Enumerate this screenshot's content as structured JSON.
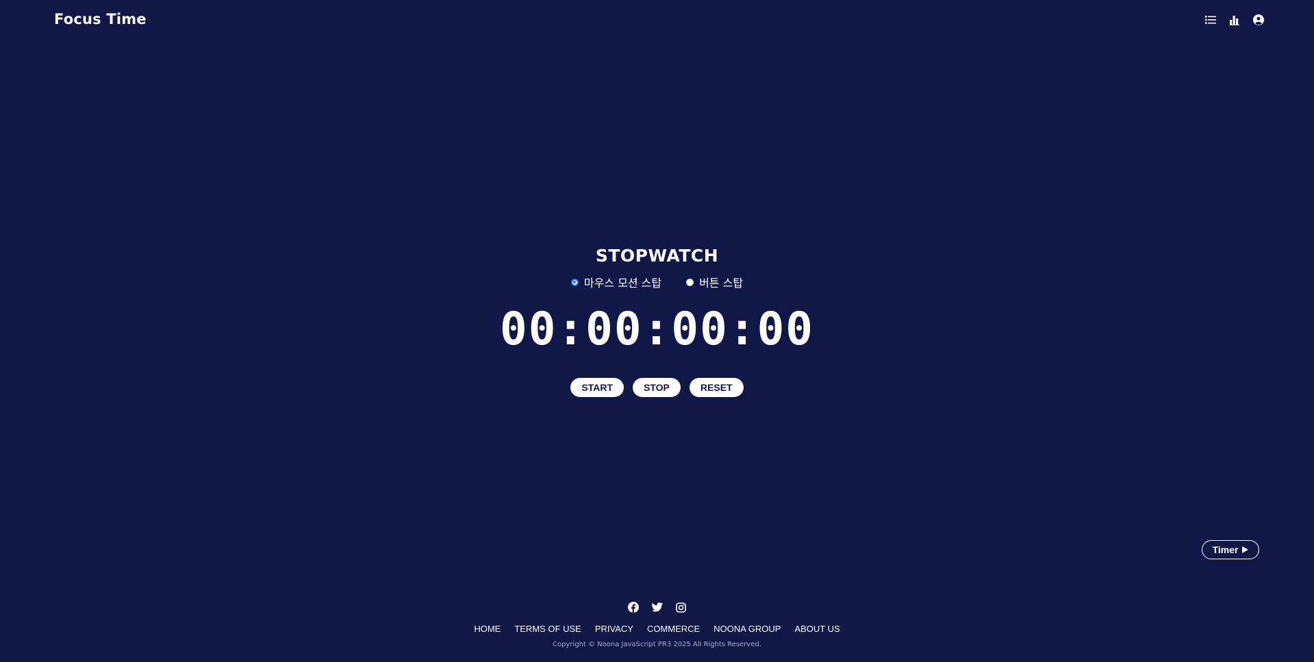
{
  "header": {
    "brand": "Focus Time",
    "icons": [
      "list-icon",
      "bar-chart-icon",
      "user-circle-icon"
    ]
  },
  "stopwatch": {
    "title": "STOPWATCH",
    "modes": [
      {
        "label": "마우스 모션 스탑",
        "selected": true
      },
      {
        "label": "버튼 스탑",
        "selected": false
      }
    ],
    "display": "00:00:00:00",
    "buttons": {
      "start": "START",
      "stop": "STOP",
      "reset": "RESET"
    }
  },
  "timer_toggle": {
    "label": "Timer",
    "icon": "play-icon"
  },
  "footer": {
    "social_icons": [
      "facebook-icon",
      "twitter-icon",
      "instagram-icon"
    ],
    "links": [
      "HOME",
      "TERMS OF USE",
      "PRIVACY",
      "COMMERCE",
      "NOONA GROUP",
      "ABOUT US"
    ],
    "copyright": "Copyright © Noona JavaScript PR3 2025 All Rights Reserved."
  },
  "colors": {
    "background": "#101848",
    "text": "#ffffff",
    "radio_accent": "#2a6cf0",
    "muted_text": "#a8adc6"
  }
}
